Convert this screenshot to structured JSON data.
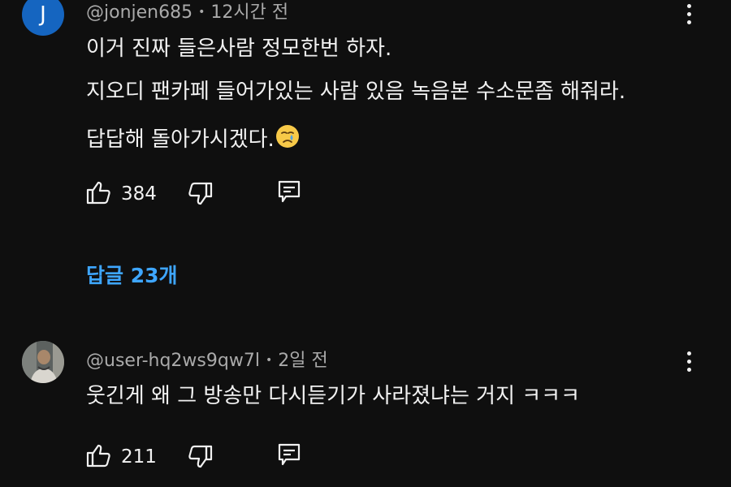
{
  "comments": [
    {
      "avatar_letter": "J",
      "handle": "@jonjen685",
      "separator": "•",
      "time": "12시간 전",
      "lines": [
        "이거 진짜 들은사람 정모한번 하자.",
        "지오디 팬카페 들어가있는 사람 있음 녹음본 수소문좀 해줘라.",
        "답답해 돌아가시겠다."
      ],
      "like_count": "384",
      "replies_label": "답글 23개"
    },
    {
      "handle": "@user-hq2ws9qw7l",
      "separator": "•",
      "time": "2일 전",
      "lines": [
        "웃긴게 왜 그 방송만 다시듣기가 사라졌냐는 거지 ㅋㅋㅋ"
      ],
      "like_count": "211"
    }
  ],
  "colors": {
    "background": "#0f0f0f",
    "text": "#f1f1f1",
    "meta": "#aaaaaa",
    "link": "#3ea6ff",
    "avatar_j": "#1565c0"
  },
  "icons": [
    "like-icon",
    "dislike-icon",
    "reply-icon",
    "more-options-icon",
    "crying-face-emoji"
  ]
}
